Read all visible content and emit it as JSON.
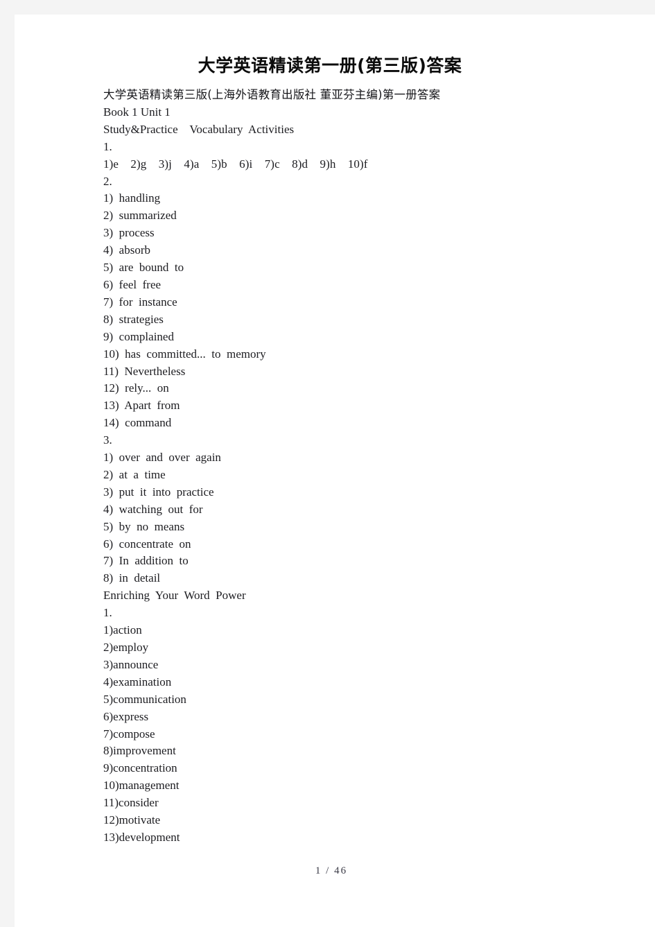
{
  "document": {
    "title": "大学英语精读第一册(第三版)答案",
    "subtitle": "大学英语精读第三版(上海外语教育出版社 董亚芬主编)第一册答案",
    "book_unit": "Book 1 Unit 1",
    "footer": "1 / 46"
  },
  "sections": [
    {
      "heading": "Study&Practice    Vocabulary  Activities"
    },
    {
      "heading": "Enriching  Your  Word  Power"
    }
  ],
  "lines": [
    "Study&Practice    Vocabulary  Activities",
    "1.",
    "1)e    2)g    3)j    4)a    5)b    6)i    7)c    8)d    9)h    10)f",
    "2.",
    "1)  handling",
    "2)  summarized",
    "3)  process",
    "4)  absorb",
    "5)  are  bound  to",
    "6)  feel  free",
    "7)  for  instance",
    "8)  strategies",
    "9)  complained",
    "10)  has  committed...  to  memory",
    "11)  Nevertheless",
    "12)  rely...  on",
    "13)  Apart  from",
    "14)  command",
    "3.",
    "1)  over  and  over  again",
    "2)  at  a  time",
    "3)  put  it  into  practice",
    "4)  watching  out  for",
    "5)  by  no  means",
    "6)  concentrate  on",
    "7)  In  addition  to",
    "8)  in  detail",
    "Enriching  Your  Word  Power",
    "1.",
    "1)action",
    "2)employ",
    "3)announce",
    "4)examination",
    "5)communication",
    "6)express",
    "7)compose",
    "8)improvement",
    "9)concentration",
    "10)management",
    "11)consider",
    "12)motivate",
    "13)development"
  ],
  "exercise_1_matching": [
    {
      "number": "1)",
      "answer": "e"
    },
    {
      "number": "2)",
      "answer": "g"
    },
    {
      "number": "3)",
      "answer": "j"
    },
    {
      "number": "4)",
      "answer": "a"
    },
    {
      "number": "5)",
      "answer": "b"
    },
    {
      "number": "6)",
      "answer": "i"
    },
    {
      "number": "7)",
      "answer": "c"
    },
    {
      "number": "8)",
      "answer": "d"
    },
    {
      "number": "9)",
      "answer": "h"
    },
    {
      "number": "10)",
      "answer": "f"
    }
  ],
  "exercise_2_words": [
    "handling",
    "summarized",
    "process",
    "absorb",
    "are bound to",
    "feel free",
    "for instance",
    "strategies",
    "complained",
    "has committed... to memory",
    "Nevertheless",
    "rely... on",
    "Apart from",
    "command"
  ],
  "exercise_3_phrases": [
    "over and over again",
    "at a time",
    "put it into practice",
    "watching out for",
    "by no means",
    "concentrate on",
    "In addition to",
    "in detail"
  ],
  "enriching_word_power": [
    "action",
    "employ",
    "announce",
    "examination",
    "communication",
    "express",
    "compose",
    "improvement",
    "concentration",
    "management",
    "consider",
    "motivate",
    "development"
  ],
  "colors": {
    "page_background": "#ffffff",
    "gutter": "#f4f4f4",
    "text": "#1c1c20",
    "title": "#0b0b0b",
    "footer_text": "#3a3a46"
  }
}
